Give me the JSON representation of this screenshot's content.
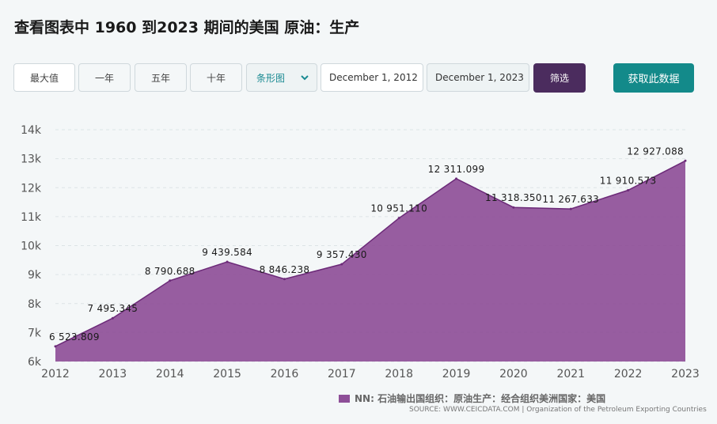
{
  "page": {
    "title": "查看图表中 1960 到2023 期间的美国 原油：生产"
  },
  "toolbar": {
    "buttons": [
      "最大值",
      "一年",
      "五年",
      "十年"
    ],
    "chart_type": "条形图",
    "date_from": "December 1, 2012",
    "date_to": "December 1, 2023",
    "filter_label": "筛选",
    "fetch_label": "获取此数据"
  },
  "colors": {
    "area": "#8e4f98",
    "line": "#6c2a78",
    "filter": "#4b2c5e",
    "fetch": "#138a8a"
  },
  "legend": {
    "label": "NN: 石油输出国组织：原油生产：经合组织美洲国家：美国"
  },
  "source": {
    "text": "SOURCE: WWW.CEICDATA.COM | Organization of the Petroleum Exporting Countries"
  },
  "chart_data": {
    "type": "area",
    "x": [
      "2012",
      "2013",
      "2014",
      "2015",
      "2016",
      "2017",
      "2018",
      "2019",
      "2020",
      "2021",
      "2022",
      "2023"
    ],
    "values": [
      6523.809,
      7495.345,
      8790.688,
      9439.584,
      8846.238,
      9357.43,
      10951.11,
      12311.099,
      11318.35,
      11267.633,
      11910.573,
      12927.088
    ],
    "data_labels": [
      "6 523.809",
      "7 495.345",
      "8 790.688",
      "9 439.584",
      "8 846.238",
      "9 357.430",
      "10 951.110",
      "12 311.099",
      "11 318.350",
      "11 267.633",
      "11 910.573",
      "12 927.088"
    ],
    "y_ticks": [
      "6k",
      "7k",
      "8k",
      "9k",
      "10k",
      "11k",
      "12k",
      "13k",
      "14k"
    ],
    "ylim": [
      6000,
      14000
    ],
    "grid": true,
    "legend_position": "bottom"
  }
}
